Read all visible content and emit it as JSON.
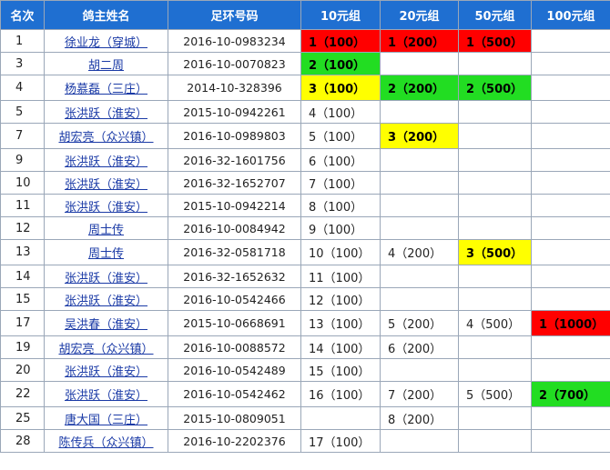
{
  "header": {
    "rank": "名次",
    "name": "鸽主姓名",
    "ring": "足环号码",
    "g10": "10元组",
    "g20": "20元组",
    "g50": "50元组",
    "g100": "100元组"
  },
  "colors": {
    "header": "#1f6fd1",
    "first": "#ff0000",
    "second": "#22dd22",
    "third": "#ffff00"
  },
  "rows": [
    {
      "rank": "1",
      "name": "徐业龙（穿城）",
      "ring": "2016-10-0983234",
      "g10": "1（100）",
      "g20": "1（200）",
      "g50": "1（500）",
      "g100": ""
    },
    {
      "rank": "3",
      "name": "胡二周",
      "ring": "2016-10-0070823",
      "g10": "2（100）",
      "g20": "",
      "g50": "",
      "g100": ""
    },
    {
      "rank": "4",
      "name": "杨慕磊（三庄）",
      "ring": "2014-10-328396",
      "g10": "3（100）",
      "g20": "2（200）",
      "g50": "2（500）",
      "g100": ""
    },
    {
      "rank": "5",
      "name": "张洪跃（淮安）",
      "ring": "2015-10-0942261",
      "g10": "4（100）",
      "g20": "",
      "g50": "",
      "g100": ""
    },
    {
      "rank": "7",
      "name": "胡宏亮（众兴镇）",
      "ring": "2016-10-0989803",
      "g10": "5（100）",
      "g20": "3（200）",
      "g50": "",
      "g100": ""
    },
    {
      "rank": "9",
      "name": "张洪跃（淮安）",
      "ring": "2016-32-1601756",
      "g10": "6（100）",
      "g20": "",
      "g50": "",
      "g100": ""
    },
    {
      "rank": "10",
      "name": "张洪跃（淮安）",
      "ring": "2016-32-1652707",
      "g10": "7（100）",
      "g20": "",
      "g50": "",
      "g100": ""
    },
    {
      "rank": "11",
      "name": "张洪跃（淮安）",
      "ring": "2015-10-0942214",
      "g10": "8（100）",
      "g20": "",
      "g50": "",
      "g100": ""
    },
    {
      "rank": "12",
      "name": "周士传",
      "ring": "2016-10-0084942",
      "g10": "9（100）",
      "g20": "",
      "g50": "",
      "g100": ""
    },
    {
      "rank": "13",
      "name": "周士传",
      "ring": "2016-32-0581718",
      "g10": "10（100）",
      "g20": "4（200）",
      "g50": "3（500）",
      "g100": ""
    },
    {
      "rank": "14",
      "name": "张洪跃（淮安）",
      "ring": "2016-32-1652632",
      "g10": "11（100）",
      "g20": "",
      "g50": "",
      "g100": ""
    },
    {
      "rank": "15",
      "name": "张洪跃（淮安）",
      "ring": "2016-10-0542466",
      "g10": "12（100）",
      "g20": "",
      "g50": "",
      "g100": ""
    },
    {
      "rank": "17",
      "name": "吴洪春（淮安）",
      "ring": "2015-10-0668691",
      "g10": "13（100）",
      "g20": "5（200）",
      "g50": "4（500）",
      "g100": "1（1000）"
    },
    {
      "rank": "19",
      "name": "胡宏亮（众兴镇）",
      "ring": "2016-10-0088572",
      "g10": "14（100）",
      "g20": "6（200）",
      "g50": "",
      "g100": ""
    },
    {
      "rank": "20",
      "name": "张洪跃（淮安）",
      "ring": "2016-10-0542489",
      "g10": "15（100）",
      "g20": "",
      "g50": "",
      "g100": ""
    },
    {
      "rank": "22",
      "name": "张洪跃（淮安）",
      "ring": "2016-10-0542462",
      "g10": "16（100）",
      "g20": "7（200）",
      "g50": "5（500）",
      "g100": "2（700）"
    },
    {
      "rank": "25",
      "name": "唐大国（三庄）",
      "ring": "2015-10-0809051",
      "g10": "",
      "g20": "8（200）",
      "g50": "",
      "g100": ""
    },
    {
      "rank": "28",
      "name": "陈传兵（众兴镇）",
      "ring": "2016-10-2202376",
      "g10": "17（100）",
      "g20": "",
      "g50": "",
      "g100": ""
    }
  ]
}
